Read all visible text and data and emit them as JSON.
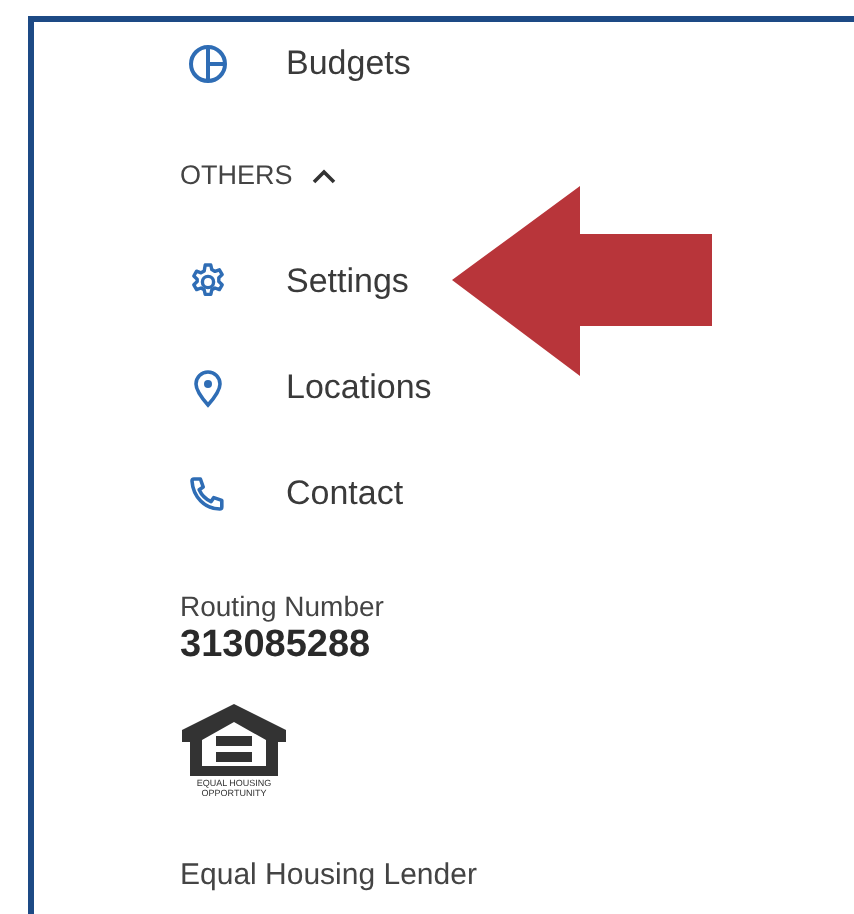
{
  "nav_top": [
    {
      "label": "Budgets"
    }
  ],
  "section": {
    "label": "OTHERS",
    "expanded": true,
    "items": [
      {
        "label": "Settings"
      },
      {
        "label": "Locations"
      },
      {
        "label": "Contact"
      }
    ]
  },
  "routing": {
    "label": "Routing Number",
    "value": "313085288"
  },
  "logo": {
    "line_1": "EQUAL HOUSING",
    "line_2": "OPPORTUNITY"
  },
  "footer": "Equal Housing Lender"
}
